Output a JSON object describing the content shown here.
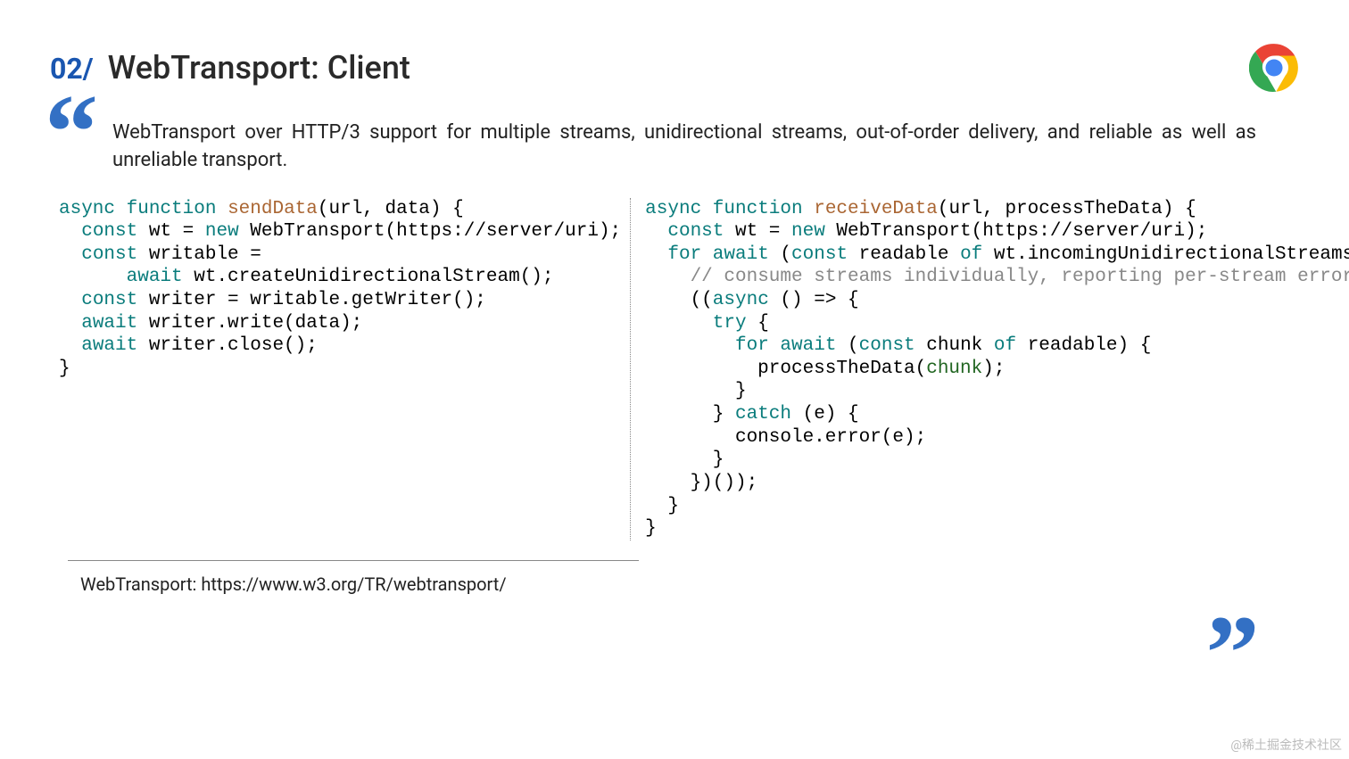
{
  "slide_number": "02/",
  "title": "WebTransport: Client",
  "description": "WebTransport over HTTP/3 support for multiple streams, unidirectional streams, out-of-order delivery, and reliable as well as unreliable transport.",
  "code_left": {
    "l1a": "async",
    "l1b": "function",
    "l1c": "sendData",
    "l1d": "(url, data) {",
    "l2a": "const",
    "l2b": " wt = ",
    "l2c": "new",
    "l2d": " WebTransport(https://server/uri);",
    "l3a": "const",
    "l3b": " writable =",
    "l4a": "await",
    "l4b": " wt.createUnidirectionalStream();",
    "l5a": "const",
    "l5b": " writer = writable.getWriter();",
    "l6a": "await",
    "l6b": " writer.write(data);",
    "l7a": "await",
    "l7b": " writer.close();",
    "l8": "}"
  },
  "code_right": {
    "l1a": "async",
    "l1b": "function",
    "l1c": "receiveData",
    "l1d": "(url, processTheData) {",
    "l2a": "const",
    "l2b": " wt = ",
    "l2c": "new",
    "l2d": " WebTransport(https://server/uri);",
    "l3a": "for",
    "l3b": "await",
    "l3c": " (",
    "l3d": "const",
    "l3e": " readable ",
    "l3f": "of",
    "l3g": " wt.incomingUnidirectionalStreams) {",
    "l4": "// consume streams individually, reporting per-stream errors",
    "l5a": "((",
    "l5b": "async",
    "l5c": " () => {",
    "l6a": "try",
    "l6b": " {",
    "l7a": "for",
    "l7b": "await",
    "l7c": " (",
    "l7d": "const",
    "l7e": " chunk ",
    "l7f": "of",
    "l7g": " readable) {",
    "l8a": "          processTheData(",
    "l8b": "chunk",
    "l8c": ");",
    "l9": "        }",
    "l10a": "      } ",
    "l10b": "catch",
    "l10c": " (e) {",
    "l11": "        console.error(e);",
    "l12": "      }",
    "l13": "    })());",
    "l14": "  }",
    "l15": "}"
  },
  "reference": "WebTransport: https://www.w3.org/TR/webtransport/",
  "watermark": "@稀土掘金技术社区",
  "open_quote": "❝",
  "close_quote": "❝"
}
